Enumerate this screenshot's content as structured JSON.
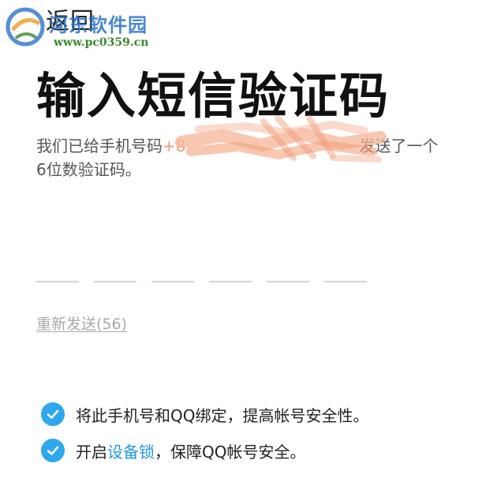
{
  "header": {
    "back_label": "返回"
  },
  "watermark": {
    "name": "河东软件园",
    "url": "www.pc0359.cn"
  },
  "main": {
    "title": "输入短信验证码",
    "subtitle_prefix": "我们已给手机号码",
    "phone_fragment": "+8",
    "subtitle_suffix": "发送了一个",
    "subtitle_line2": "6位数验证码。",
    "code_slots": 6,
    "resend_label": "重新发送(56)"
  },
  "options": [
    {
      "text": "将此手机号和QQ绑定，提高帐号安全性。",
      "checked": true
    },
    {
      "text_before": "开启",
      "link": "设备锁",
      "text_after": "，保障QQ帐号安全。",
      "checked": true
    }
  ],
  "colors": {
    "accent": "#2ea8ec",
    "link": "#2596e4",
    "muted": "#a9a9a9",
    "redaction": "#f4a27e"
  }
}
